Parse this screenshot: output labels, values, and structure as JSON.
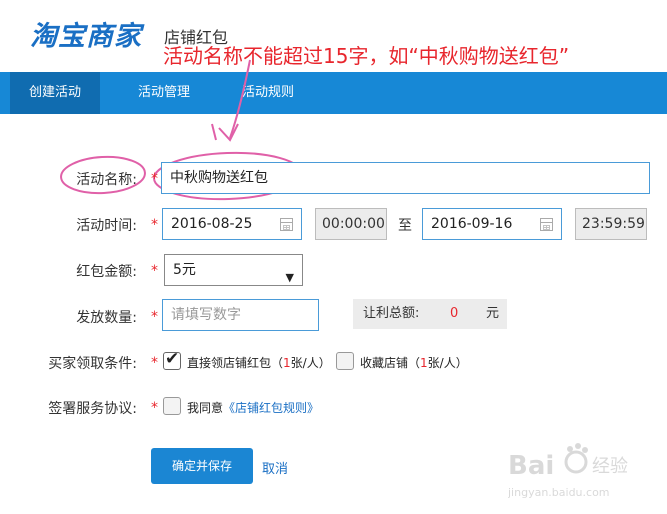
{
  "header": {
    "logo": "淘宝商家",
    "subtitle": "店铺红包",
    "annotation": "活动名称不能超过15字，如“中秋购物送红包”"
  },
  "nav": {
    "tabs": [
      {
        "label": "创建活动",
        "active": true
      },
      {
        "label": "活动管理",
        "active": false
      },
      {
        "label": "活动规则",
        "active": false
      }
    ]
  },
  "form": {
    "name": {
      "label": "活动名称:",
      "required": "*",
      "value": "中秋购物送红包"
    },
    "time": {
      "label": "活动时间:",
      "required": "*",
      "start_date": "2016-08-25",
      "start_time": "00:00:00",
      "separator": "至",
      "end_date": "2016-09-16",
      "end_time": "23:59:59"
    },
    "amount": {
      "label": "红包金额:",
      "required": "*",
      "value": "5元"
    },
    "quantity": {
      "label": "发放数量:",
      "required": "*",
      "placeholder": "请填写数字",
      "total_label": "让利总额:",
      "total_value": "0",
      "total_unit": "元"
    },
    "conditions": {
      "label": "买家领取条件:",
      "required": "*",
      "option1": {
        "prefix": "直接领店铺红包（",
        "num": "1",
        "suffix": "张/人）",
        "checked": true
      },
      "option2": {
        "prefix": "收藏店铺（",
        "num": "1",
        "suffix": "张/人）",
        "checked": false
      }
    },
    "agreement": {
      "label": "签署服务协议:",
      "required": "*",
      "text": "我同意",
      "link": "《店铺红包规则》",
      "checked": false
    }
  },
  "actions": {
    "submit": "确定并保存",
    "cancel": "取消"
  },
  "watermark": {
    "brand": "Bai",
    "brand2": "经验",
    "url": "jingyan.baidu.com"
  },
  "colors": {
    "primary": "#1788d6",
    "active_tab": "#106cb0",
    "annotation": "#e8262d",
    "link": "#1a6fc4"
  }
}
